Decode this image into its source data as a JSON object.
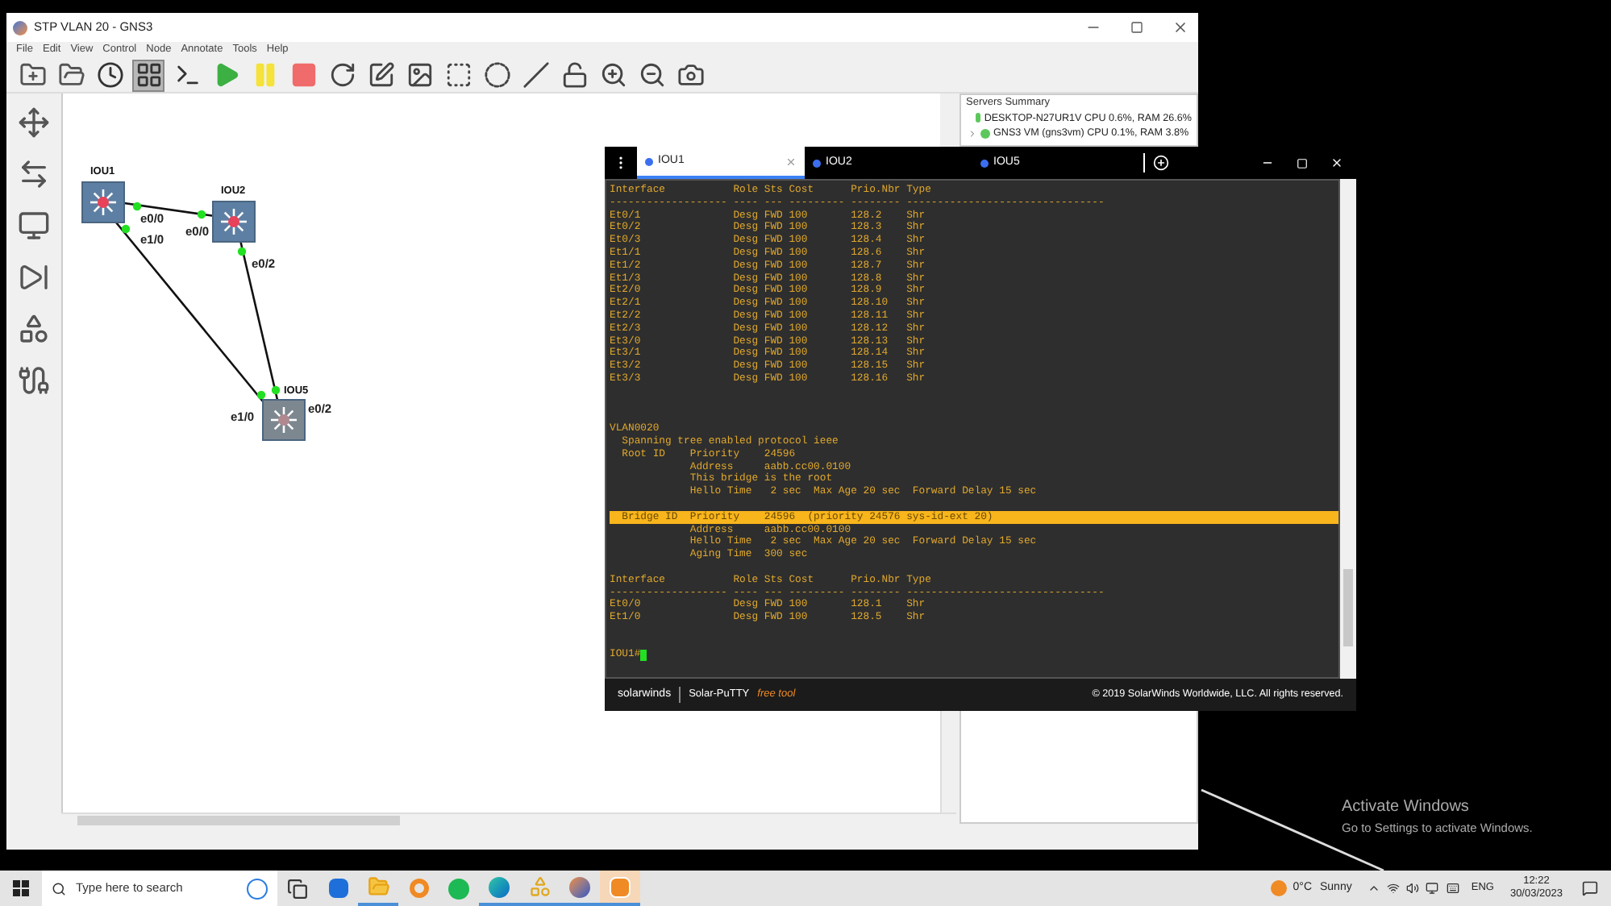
{
  "gns3": {
    "title": "STP VLAN 20 - GNS3",
    "menu": [
      "File",
      "Edit",
      "View",
      "Control",
      "Node",
      "Annotate",
      "Tools",
      "Help"
    ],
    "toolbar": [
      {
        "kind": "new",
        "selected": false
      },
      {
        "kind": "open",
        "selected": false
      },
      {
        "kind": "snapshot",
        "selected": false
      },
      {
        "kind": "grid",
        "selected": true
      },
      {
        "kind": "console",
        "selected": false
      },
      {
        "kind": "start",
        "selected": false
      },
      {
        "kind": "suspend",
        "selected": false
      },
      {
        "kind": "stop",
        "selected": false
      },
      {
        "kind": "reload",
        "selected": false
      },
      {
        "kind": "note",
        "selected": false
      },
      {
        "kind": "image",
        "selected": false
      },
      {
        "kind": "rect",
        "selected": false
      },
      {
        "kind": "ellipse",
        "selected": false
      },
      {
        "kind": "line",
        "selected": false
      },
      {
        "kind": "lock",
        "selected": false
      },
      {
        "kind": "zoomin",
        "selected": false
      },
      {
        "kind": "zoomout",
        "selected": false
      },
      {
        "kind": "screenshot",
        "selected": false
      }
    ],
    "nodes": [
      {
        "label": "IOU1",
        "color": "#e8425a"
      },
      {
        "label": "IOU2",
        "color": "#e8425a"
      },
      {
        "label": "IOU5",
        "color": "#b08890"
      }
    ],
    "links": [
      {
        "a_port": "e0/0",
        "b_port": "e0/0"
      },
      {
        "a_port": "e1/0",
        "b_port": "e1/0"
      },
      {
        "a_port": "e0/2",
        "b_port": "e0/2"
      }
    ],
    "servers_summary": {
      "title": "Servers Summary",
      "servers": [
        {
          "name": "DESKTOP-N27UR1V CPU 0.6%, RAM 26.6%",
          "expandable": false
        },
        {
          "name": "GNS3 VM (gns3vm) CPU 0.1%, RAM 3.8%",
          "expandable": true
        }
      ]
    }
  },
  "terminal": {
    "tabs": [
      {
        "label": "IOU1",
        "selected": true
      },
      {
        "label": "IOU2",
        "selected": false
      },
      {
        "label": "IOU5",
        "selected": false
      }
    ],
    "lines": [
      {
        "kind": "text",
        "text": "Interface           Role Sts Cost      Prio.Nbr Type",
        "highlighted": false
      },
      {
        "kind": "text",
        "text": "------------------- ---- --- --------- -------- --------------------------------",
        "highlighted": false
      },
      {
        "kind": "text",
        "text": "Et0/1               Desg FWD 100       128.2    Shr",
        "highlighted": false
      },
      {
        "kind": "text",
        "text": "Et0/2               Desg FWD 100       128.3    Shr",
        "highlighted": false
      },
      {
        "kind": "text",
        "text": "Et0/3               Desg FWD 100       128.4    Shr",
        "highlighted": false
      },
      {
        "kind": "text",
        "text": "Et1/1               Desg FWD 100       128.6    Shr",
        "highlighted": false
      },
      {
        "kind": "text",
        "text": "Et1/2               Desg FWD 100       128.7    Shr",
        "highlighted": false
      },
      {
        "kind": "text",
        "text": "Et1/3               Desg FWD 100       128.8    Shr",
        "highlighted": false
      },
      {
        "kind": "text",
        "text": "Et2/0               Desg FWD 100       128.9    Shr",
        "highlighted": false
      },
      {
        "kind": "text",
        "text": "Et2/1               Desg FWD 100       128.10   Shr",
        "highlighted": false
      },
      {
        "kind": "text",
        "text": "Et2/2               Desg FWD 100       128.11   Shr",
        "highlighted": false
      },
      {
        "kind": "text",
        "text": "Et2/3               Desg FWD 100       128.12   Shr",
        "highlighted": false
      },
      {
        "kind": "text",
        "text": "Et3/0               Desg FWD 100       128.13   Shr",
        "highlighted": false
      },
      {
        "kind": "text",
        "text": "Et3/1               Desg FWD 100       128.14   Shr",
        "highlighted": false
      },
      {
        "kind": "text",
        "text": "Et3/2               Desg FWD 100       128.15   Shr",
        "highlighted": false
      },
      {
        "kind": "text",
        "text": "Et3/3               Desg FWD 100       128.16   Shr",
        "highlighted": false
      },
      {
        "kind": "blank"
      },
      {
        "kind": "blank"
      },
      {
        "kind": "blank"
      },
      {
        "kind": "text",
        "text": "VLAN0020",
        "highlighted": false
      },
      {
        "kind": "text",
        "text": "  Spanning tree enabled protocol ieee",
        "highlighted": false
      },
      {
        "kind": "text",
        "text": "  Root ID    Priority    24596",
        "highlighted": false
      },
      {
        "kind": "text",
        "text": "             Address     aabb.cc00.0100",
        "highlighted": false
      },
      {
        "kind": "text",
        "text": "             This bridge is the root",
        "highlighted": false
      },
      {
        "kind": "text",
        "text": "             Hello Time   2 sec  Max Age 20 sec  Forward Delay 15 sec",
        "highlighted": false
      },
      {
        "kind": "blank"
      },
      {
        "kind": "text",
        "text": "  Bridge ID  Priority    24596  (priority 24576 sys-id-ext 20)",
        "highlighted": true
      },
      {
        "kind": "text",
        "text": "             Address     aabb.cc00.0100",
        "highlighted": false
      },
      {
        "kind": "text",
        "text": "             Hello Time   2 sec  Max Age 20 sec  Forward Delay 15 sec",
        "highlighted": false
      },
      {
        "kind": "text",
        "text": "             Aging Time  300 sec",
        "highlighted": false
      },
      {
        "kind": "blank"
      },
      {
        "kind": "text",
        "text": "Interface           Role Sts Cost      Prio.Nbr Type",
        "highlighted": false
      },
      {
        "kind": "text",
        "text": "------------------- ---- --- --------- -------- --------------------------------",
        "highlighted": false
      },
      {
        "kind": "text",
        "text": "Et0/0               Desg FWD 100       128.1    Shr",
        "highlighted": false
      },
      {
        "kind": "text",
        "text": "Et1/0               Desg FWD 100       128.5    Shr",
        "highlighted": false
      },
      {
        "kind": "blank"
      },
      {
        "kind": "blank"
      },
      {
        "kind": "prompt",
        "text": "IOU1#",
        "highlighted": false
      }
    ],
    "footer": {
      "brand": "solarwinds",
      "product": "Solar-PuTTY",
      "tag": "free tool",
      "copyright": "© 2019 SolarWinds Worldwide, LLC. All rights reserved."
    }
  },
  "activation": {
    "title": "Activate Windows",
    "subtitle": "Go to Settings to activate Windows."
  },
  "taskbar": {
    "search_placeholder": "Type here to search",
    "apps": [
      {
        "kind": "taskview",
        "selected": false,
        "running": false
      },
      {
        "kind": "store",
        "selected": false,
        "running": false
      },
      {
        "kind": "explorer",
        "selected": false,
        "running": true
      },
      {
        "kind": "blender",
        "selected": false,
        "running": false
      },
      {
        "kind": "spotify",
        "selected": false,
        "running": false
      },
      {
        "kind": "edge",
        "selected": false,
        "running": true
      },
      {
        "kind": "network",
        "selected": false,
        "running": true
      },
      {
        "kind": "gns3",
        "selected": false,
        "running": true
      },
      {
        "kind": "putty",
        "selected": true,
        "running": true
      }
    ],
    "weather_temp": "0°C",
    "weather_condition": "Sunny",
    "language": "ENG",
    "time": "12:22",
    "date": "30/03/2023"
  }
}
